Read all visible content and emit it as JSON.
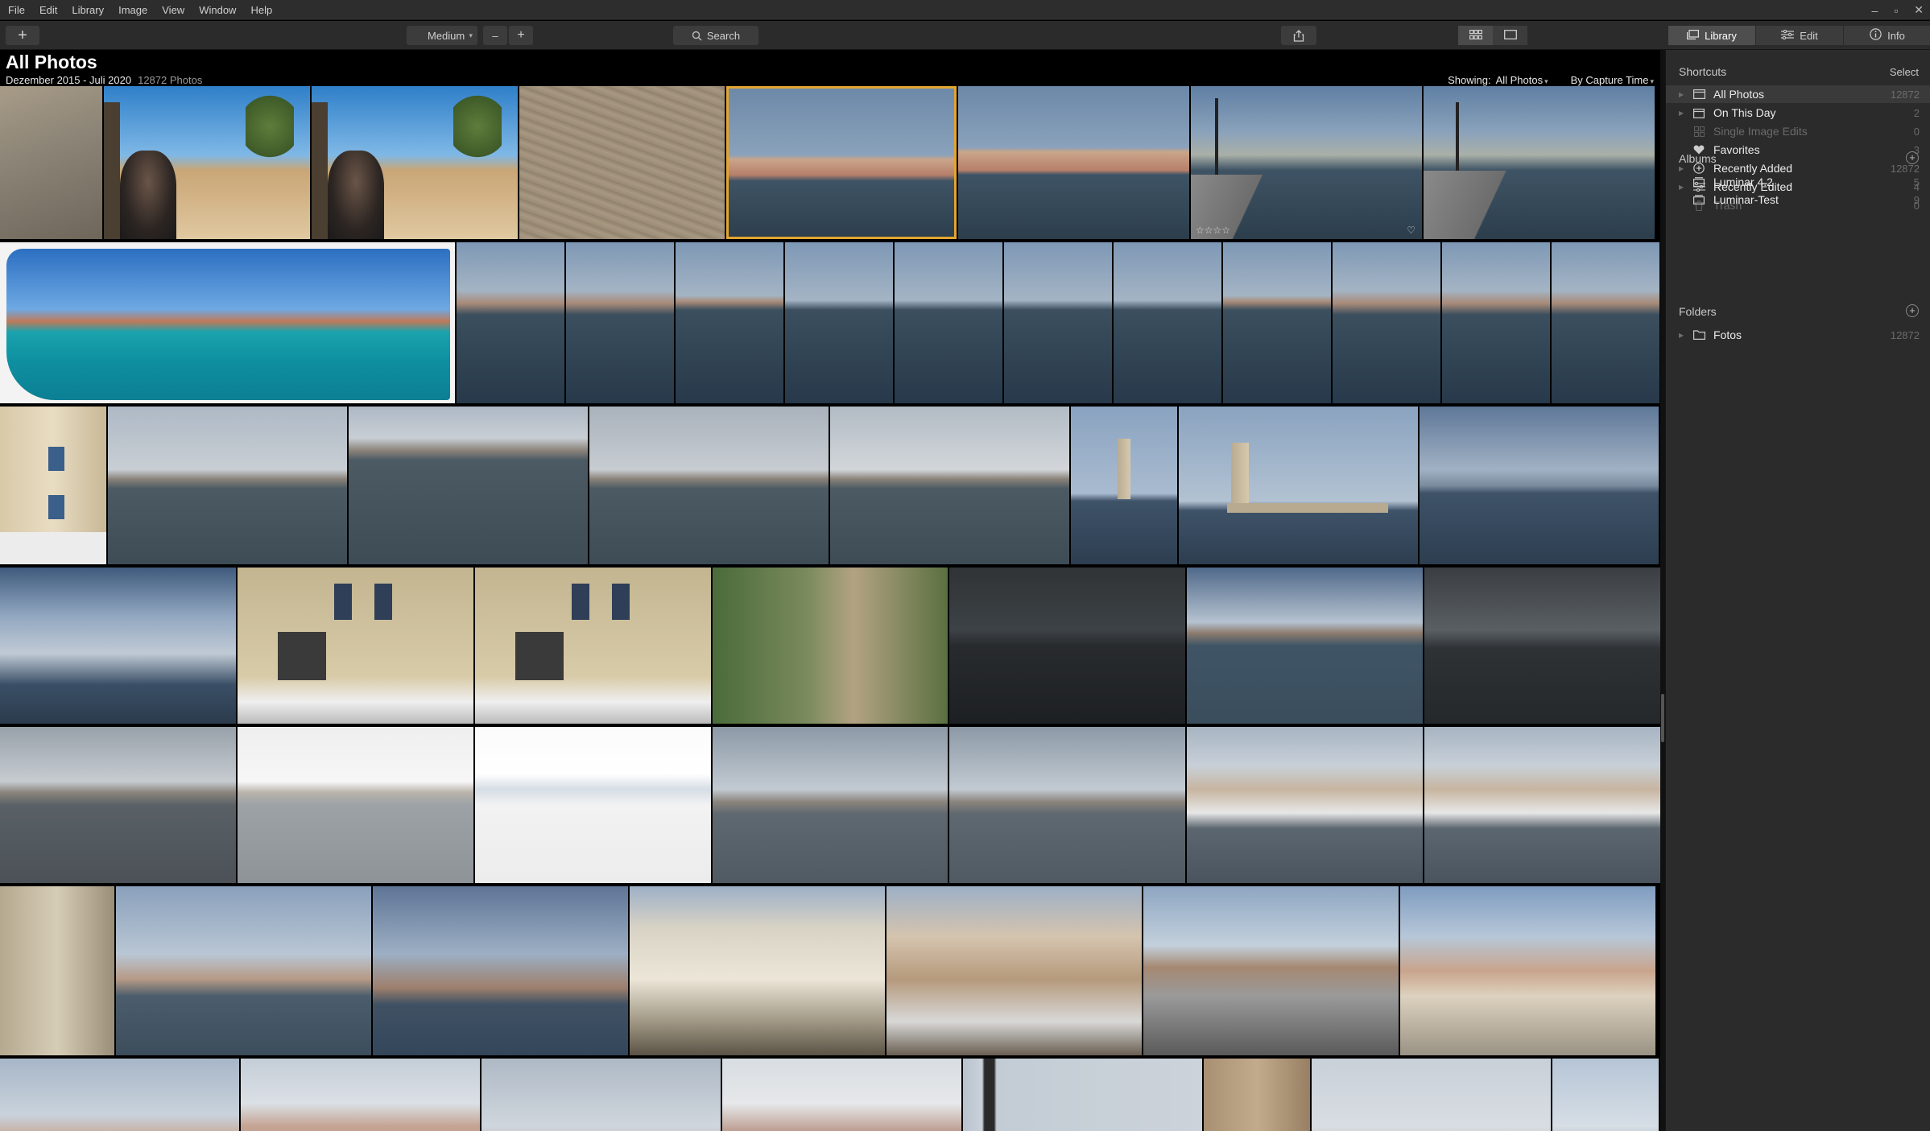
{
  "menu": [
    "File",
    "Edit",
    "Library",
    "Image",
    "View",
    "Window",
    "Help"
  ],
  "window_controls": [
    "–",
    "▫",
    "✕"
  ],
  "toolbar": {
    "add_label": "+",
    "size_select": "Medium",
    "zoom_minus": "–",
    "zoom_plus": "+",
    "search_placeholder": "Search",
    "modes": [
      "Library",
      "Edit",
      "Info"
    ]
  },
  "content": {
    "title": "All Photos",
    "date_range": "Dezember 2015 - Juli 2020",
    "photo_count": "12872 Photos",
    "showing_label": "Showing:",
    "showing_value": "All Photos",
    "sort_value": "By Capture Time"
  },
  "sidebar": {
    "shortcuts_title": "Shortcuts",
    "select_label": "Select",
    "shortcuts": [
      {
        "label": "All Photos",
        "count": "12872",
        "icon": "photos-icon",
        "active": true,
        "dim": false,
        "expandable": true
      },
      {
        "label": "On This Day",
        "count": "2",
        "icon": "calendar-icon",
        "active": false,
        "dim": false,
        "expandable": true
      },
      {
        "label": "Single Image Edits",
        "count": "0",
        "icon": "grid-icon",
        "active": false,
        "dim": true,
        "expandable": false
      },
      {
        "label": "Favorites",
        "count": "3",
        "icon": "heart-icon",
        "active": false,
        "dim": false,
        "expandable": false
      },
      {
        "label": "Recently Added",
        "count": "12872",
        "icon": "plus-circle-icon",
        "active": false,
        "dim": false,
        "expandable": true
      },
      {
        "label": "Recently Edited",
        "count": "4",
        "icon": "sliders-icon",
        "active": false,
        "dim": false,
        "expandable": true
      },
      {
        "label": "Trash",
        "count": "0",
        "icon": "trash-icon",
        "active": false,
        "dim": true,
        "expandable": false
      }
    ],
    "albums_title": "Albums",
    "albums": [
      {
        "label": "Luminar 4.2",
        "count": "5"
      },
      {
        "label": "Luminar-Test",
        "count": "9"
      }
    ],
    "folders_title": "Folders",
    "folders": [
      {
        "label": "Fotos",
        "count": "12872"
      }
    ]
  },
  "photo_theme_colors": {
    "sky": "#b9c8d8",
    "sea": "#4d5c66",
    "selection": "#e3a532"
  }
}
